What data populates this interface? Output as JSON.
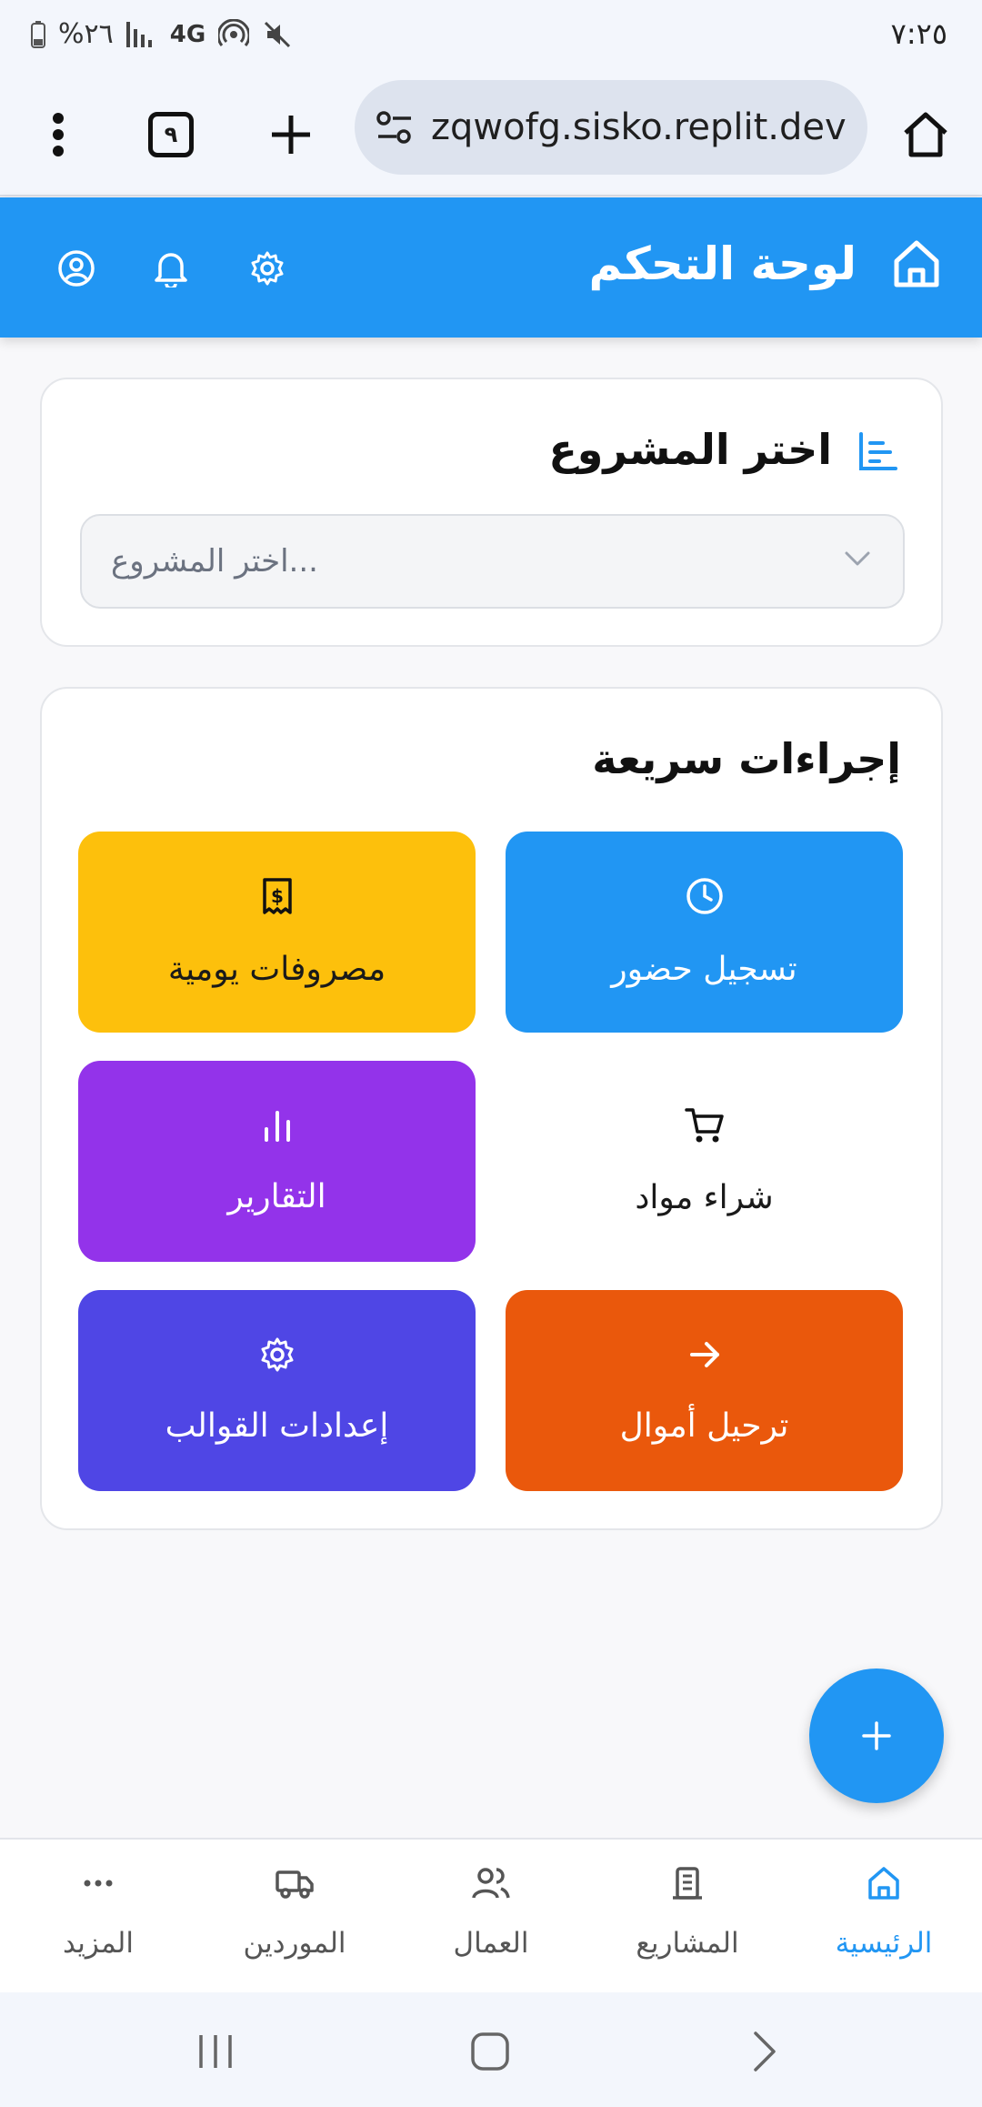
{
  "status_bar": {
    "time": "٧:٢٥",
    "battery": "%٢٦",
    "network": "4G"
  },
  "browser": {
    "url": "zqwofg.sisko.replit.dev",
    "tab_count": "٩"
  },
  "header": {
    "title": "لوحة التحكم"
  },
  "project_card": {
    "title": "اختر المشروع",
    "select_placeholder": "...اختر المشروع"
  },
  "quick_actions": {
    "title": "إجراءات سريعة",
    "items": [
      {
        "label": "تسجيل حضور",
        "icon": "clock-icon",
        "bg": "#2196f3",
        "fg": "#ffffff"
      },
      {
        "label": "مصروفات يومية",
        "icon": "receipt-icon",
        "bg": "#fdc00c",
        "fg": "#1a1a1a"
      },
      {
        "label": "شراء مواد",
        "icon": "cart-icon",
        "bg": "#ffffff",
        "fg": "#1a1a1a"
      },
      {
        "label": "التقارير",
        "icon": "bar-chart-icon",
        "bg": "#9333ea",
        "fg": "#ffffff"
      },
      {
        "label": "ترحيل أموال",
        "icon": "arrow-right-icon",
        "bg": "#ea580c",
        "fg": "#ffffff"
      },
      {
        "label": "إعدادات القوالب",
        "icon": "gear-icon",
        "bg": "#4f46e5",
        "fg": "#ffffff"
      }
    ]
  },
  "bottom_nav": [
    {
      "label": "الرئيسية",
      "icon": "home-icon",
      "active": true
    },
    {
      "label": "المشاريع",
      "icon": "building-icon"
    },
    {
      "label": "العمال",
      "icon": "users-icon"
    },
    {
      "label": "الموردين",
      "icon": "truck-icon"
    },
    {
      "label": "المزيد",
      "icon": "more-icon"
    }
  ],
  "colors": {
    "primary": "#2196f3",
    "accent_amber": "#fdc00c",
    "accent_purple": "#9333ea",
    "accent_orange": "#ea580c",
    "accent_indigo": "#4f46e5"
  }
}
